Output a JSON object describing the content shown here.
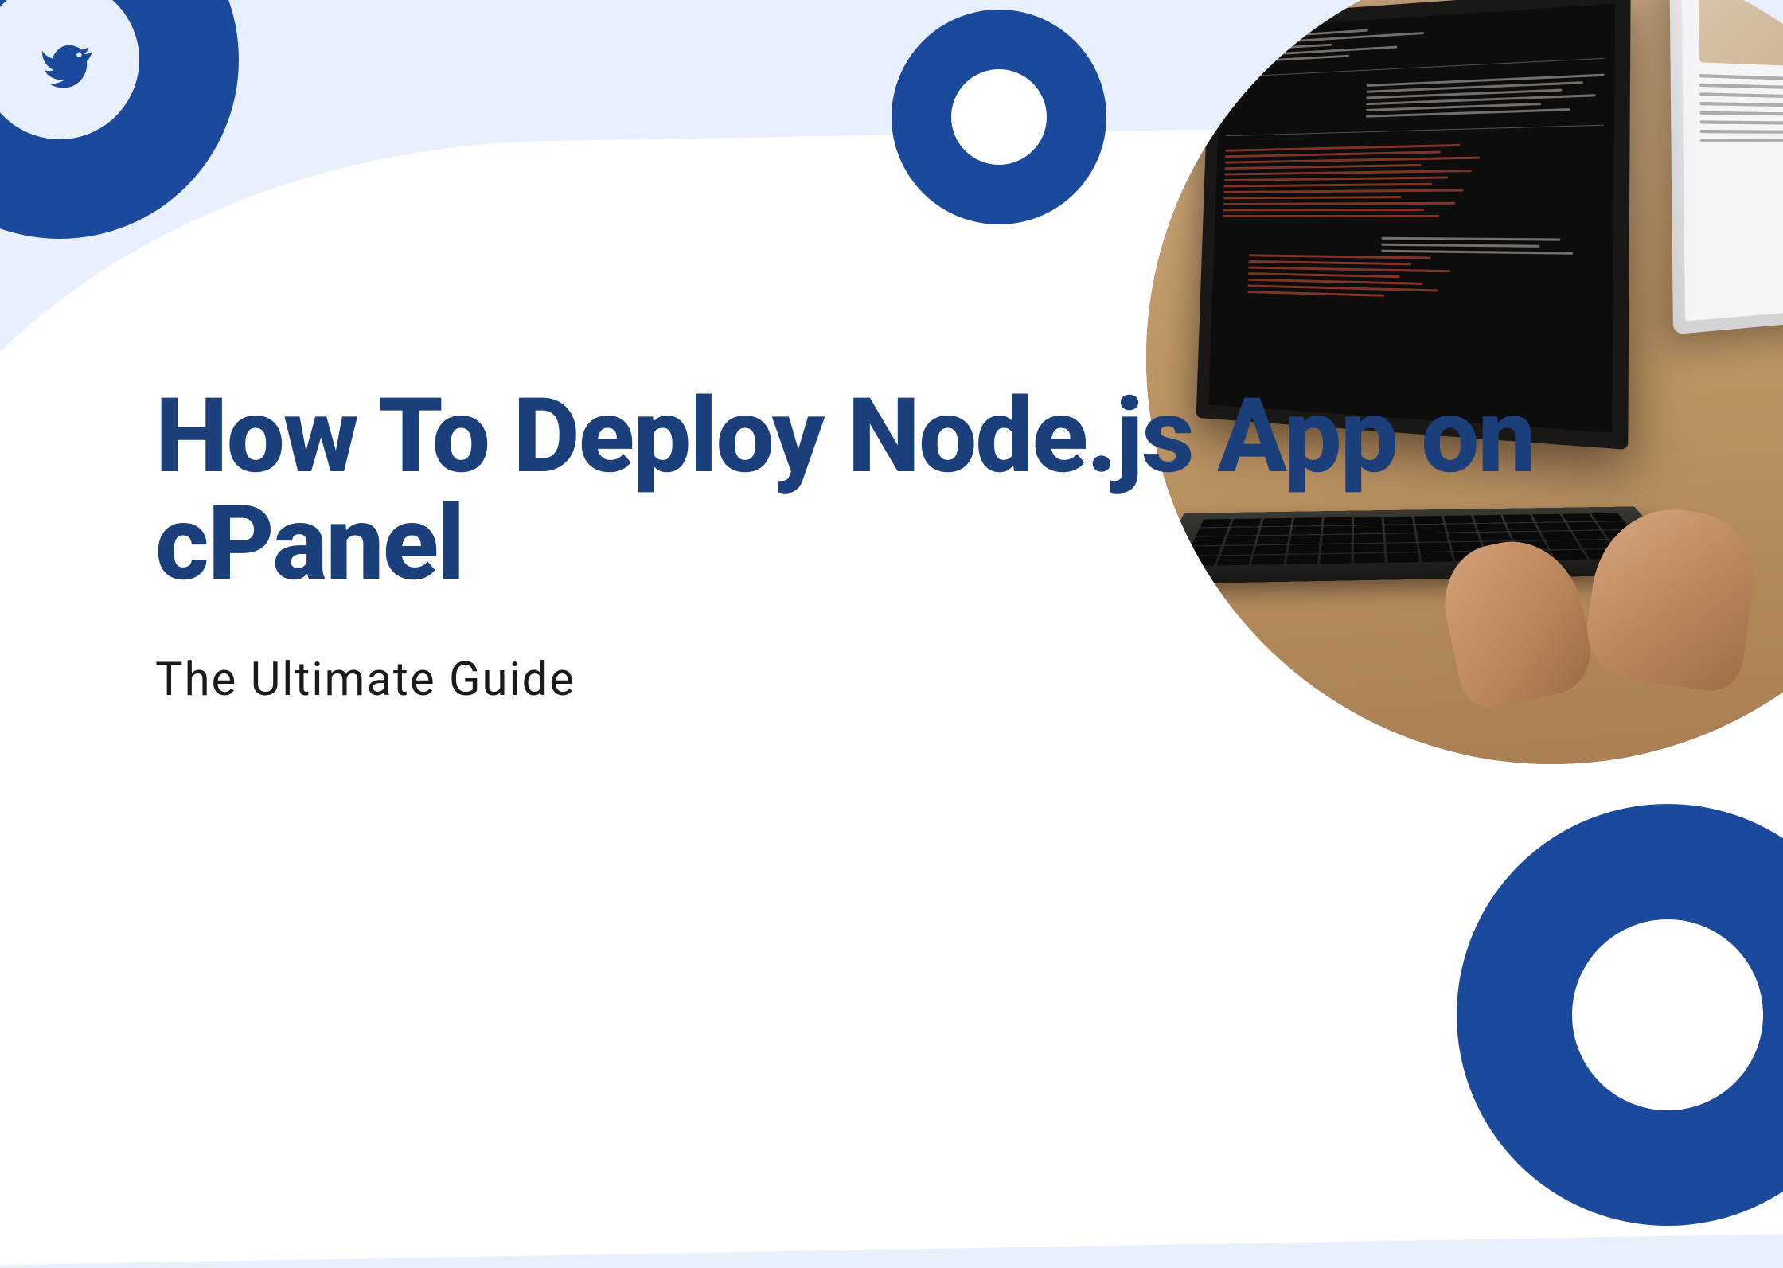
{
  "title": "How To Deploy Node.js App on cPanel",
  "subtitle": "The Ultimate Guide",
  "colors": {
    "accent": "#1b4a9c",
    "title": "#1b3f7a",
    "background_light": "#e8f0fe",
    "background_white": "#ffffff",
    "subtitle": "#1a1a1a"
  },
  "logo": "bird-icon"
}
